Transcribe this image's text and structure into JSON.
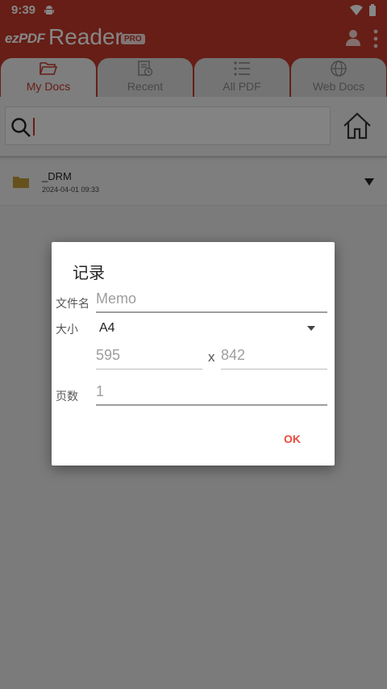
{
  "status_bar": {
    "time": "9:39"
  },
  "app_bar": {
    "logo_ez": "ezPDF",
    "logo_reader": "Reader",
    "logo_badge": "PRO"
  },
  "tabs": [
    {
      "label": "My Docs",
      "icon": "folder-open-icon",
      "active": true
    },
    {
      "label": "Recent",
      "icon": "recent-doc-icon",
      "active": false
    },
    {
      "label": "All PDF",
      "icon": "list-icon",
      "active": false
    },
    {
      "label": "Web Docs",
      "icon": "globe-icon",
      "active": false
    }
  ],
  "search": {
    "value": ""
  },
  "files": [
    {
      "name": "_DRM",
      "date": "2024-04-01 09:33",
      "icon": "folder-icon"
    }
  ],
  "dialog": {
    "title": "记录",
    "file_name_label": "文件名",
    "file_name_placeholder": "Memo",
    "size_label": "大小",
    "size_value": "A4",
    "width_value": "595",
    "times": "x",
    "height_value": "842",
    "pages_label": "页数",
    "pages_value": "1",
    "ok_label": "OK"
  },
  "colors": {
    "brand_red": "#c0392b",
    "ok_red": "#e74c3c"
  }
}
